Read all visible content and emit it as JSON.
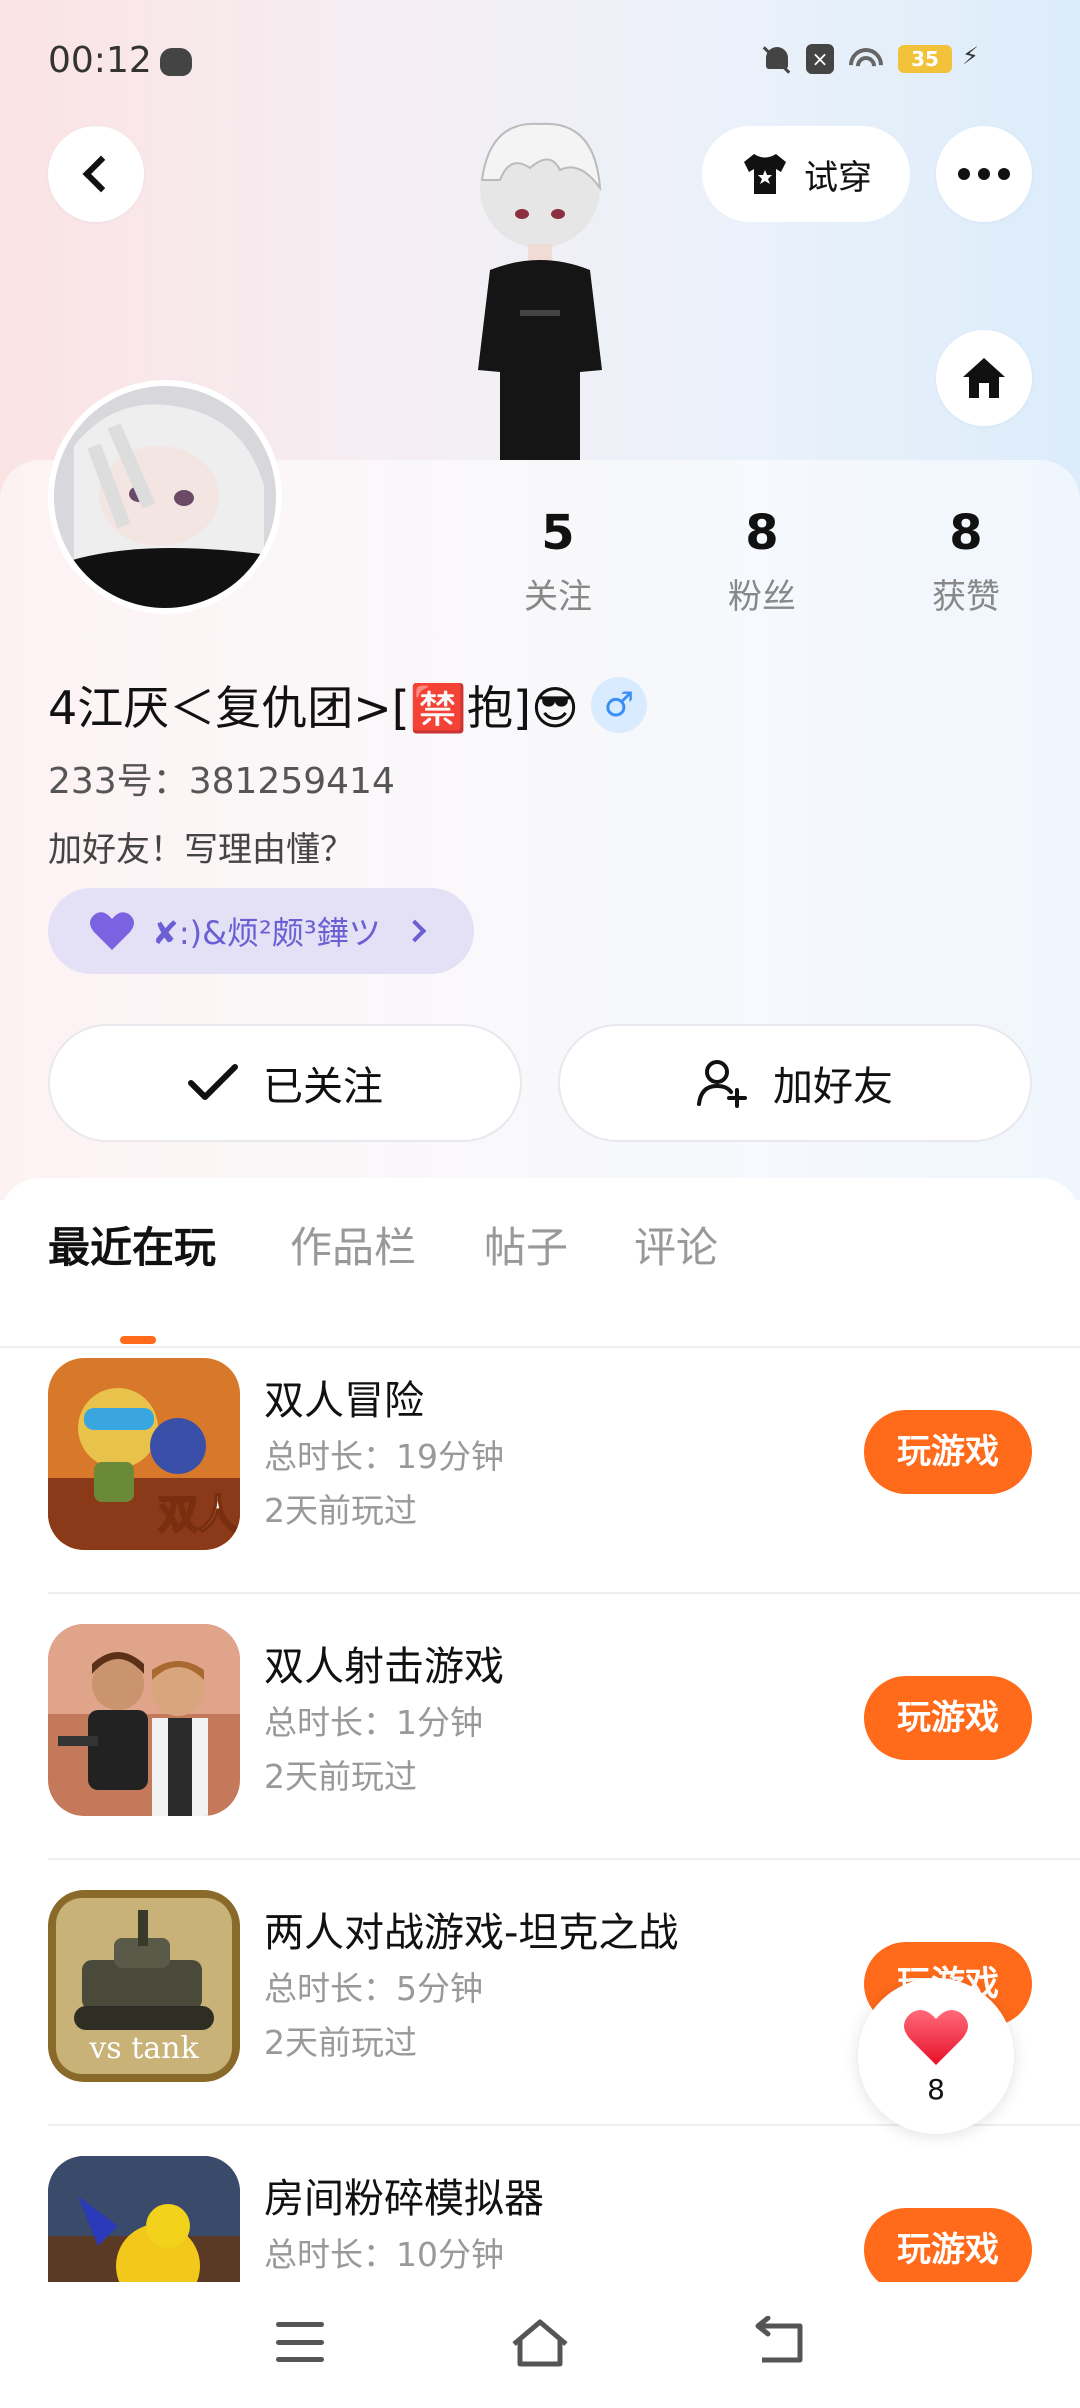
{
  "status": {
    "time": "00:12",
    "battery": "35",
    "sim_label": "×"
  },
  "header": {
    "try_on_label": "试穿"
  },
  "profile": {
    "stats": [
      {
        "value": "5",
        "label": "关注"
      },
      {
        "value": "8",
        "label": "粉丝"
      },
      {
        "value": "8",
        "label": "获赞"
      }
    ],
    "nickname": "4江厌＜复仇团>[🈲抱]😎",
    "gender": "♂",
    "uid": "233号：381259414",
    "bio": "加好友！写理由懂？",
    "guild_name": "✘:)&烦²颇³鏵ツ",
    "followed_label": "已关注",
    "add_friend_label": "加好友"
  },
  "tabs": [
    {
      "label": "最近在玩",
      "active": true
    },
    {
      "label": "作品栏",
      "active": false
    },
    {
      "label": "帖子",
      "active": false
    },
    {
      "label": "评论",
      "active": false
    }
  ],
  "games": [
    {
      "title": "双人冒险",
      "duration": "总时长：19分钟",
      "last_played": "2天前玩过",
      "play_label": "玩游戏",
      "icon_text": "双人"
    },
    {
      "title": "双人射击游戏",
      "duration": "总时长：1分钟",
      "last_played": "2天前玩过",
      "play_label": "玩游戏",
      "icon_text": ""
    },
    {
      "title": "两人对战游戏-坦克之战",
      "duration": "总时长：5分钟",
      "last_played": "2天前玩过",
      "play_label": "玩游戏",
      "icon_text": "vs tank"
    },
    {
      "title": "房间粉碎模拟器",
      "duration": "总时长：10分钟",
      "last_played": "",
      "play_label": "玩游戏",
      "icon_text": ""
    }
  ],
  "float_like": {
    "count": "8"
  },
  "colors": {
    "accent": "#ff6b1a",
    "guild_bg": "#e4e1f7",
    "guild_text": "#6b5fd3",
    "gender_bg": "#d9ebff"
  }
}
